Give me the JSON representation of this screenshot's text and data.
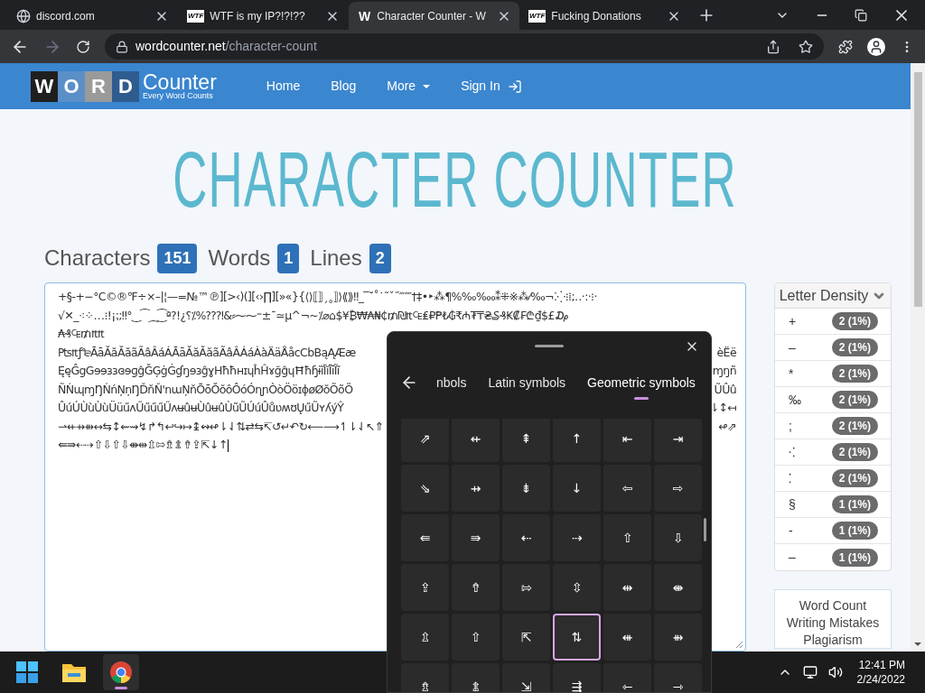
{
  "browser": {
    "tabs": [
      {
        "title": "discord.com",
        "kind": "globe",
        "selected": false
      },
      {
        "title": "WTF is my IP?!?!??",
        "kind": "text",
        "favicon": "WTF",
        "selected": false
      },
      {
        "title": "Character Counter - W",
        "kind": "text",
        "favicon": "W",
        "selected": true
      },
      {
        "title": "Fucking Donations",
        "kind": "text",
        "favicon": "WTF",
        "selected": false
      }
    ],
    "url_host": "wordcounter.net",
    "url_path": "/character-count"
  },
  "site": {
    "logo_letters": [
      "W",
      "O",
      "R",
      "D"
    ],
    "logo_name": "Counter",
    "tagline": "Every Word Counts",
    "nav": [
      {
        "label": "Home",
        "kind": "link"
      },
      {
        "label": "Blog",
        "kind": "link"
      },
      {
        "label": "More",
        "kind": "dropdown"
      },
      {
        "label": "Sign In",
        "kind": "signin"
      }
    ]
  },
  "heading": "CHARACTER COUNTER",
  "stats": [
    {
      "label": "Characters",
      "value": "151"
    },
    {
      "label": "Words",
      "value": "1"
    },
    {
      "label": "Lines",
      "value": "2"
    }
  ],
  "text_lines": [
    {
      "start": "+§-+−°C©®℉÷×–|¦—=№™℗][>‹)(][‹›∏][»«}{⟨⟩⟦⟧ˏ˳⟧⟩⟪⟫‼_‾˘˚˙˜ˇ˝‴⁗†‡•‣⁂¶%‰‱⁑⁜※⁂⁄‰¬⁚⁛⁝⁞;‥·:·⁝·"
    },
    {
      "start": "√✕_⁖⁘…⁝!¡⁏;‼°‿⁀⁔⁐ª?!¿⸮⁒%⁇⁈&⸗⁓⁓⁼±¯≃µ^¬~⁒⌀⌂$¥₿₩₳₦₵₥₪₶₠₤₽₱₺₲₹₼₮₸₴₷₰₭₡₣₾₫$£₯"
    },
    {
      "start": "₳₰₠₥₶₶"
    },
    {
      "start": "₧₶ƒ₻ĀāĂăĂăãÃâÂáÁĀāĂăĂăãÃâÂÁáÀàÄäÅåcCbBąĄÆæ",
      "end": "èËë"
    },
    {
      "start": "ĘęĜgGɘɘɜɜɞɘɡĝĞĢġĠɠŋɘɜĝɣHħħʜɪɥĥĤɤğĝɥĦħɧɨĩĬĭĪīĨĩ",
      "end": "ɱŋñ"
    },
    {
      "start": "ÑŃɰɱŊŃńŅņŊĎňŇ'nɯŅňŌōŎŏôÔóÓɳɲÒòÖöɪɸøØŏÕõÕ",
      "end": "ŨÛû"
    },
    {
      "start": "ÛúÚÙùÙùÜüűʌŰűűűŰʌʉûʉÙûʉûÙũŨÚúÛůʋʍʊŲűŨʏʎýŶ",
      "end": "⇂↕↤"
    },
    {
      "start": "⇀⇷⇸⇻↔⇆↕⇜⇝↯↱↰↩↪↦↨↭↫⇂⇃⇅⇄⇆↸↺↵↶↻⟵⟶↿⇂⇃↖⇑",
      "end": "↫⇗"
    },
    {
      "start": "⇚⇛⇠⇢⇧⇩⇧⇩⇼⇹⇫⇰⇯⇭⇮⇪⇱↓↑"
    }
  ],
  "density": {
    "title": "Letter Density",
    "rows": [
      {
        "symbol": "+",
        "count": "2 (1%)"
      },
      {
        "symbol": "–",
        "count": "2 (1%)"
      },
      {
        "symbol": "*",
        "count": "2 (1%)"
      },
      {
        "symbol": "‰",
        "count": "2 (1%)"
      },
      {
        "symbol": ";",
        "count": "2 (1%)"
      },
      {
        "symbol": "⁖",
        "count": "2 (1%)"
      },
      {
        "symbol": "⁚",
        "count": "2 (1%)"
      },
      {
        "symbol": "§",
        "count": "1 (1%)"
      },
      {
        "symbol": "-",
        "count": "1 (1%)"
      },
      {
        "symbol": "–",
        "count": "1 (1%)"
      }
    ]
  },
  "promo": [
    "Word Count",
    "Writing Mistakes",
    "Plagiarism"
  ],
  "symbol_panel": {
    "tabs": [
      {
        "label": "nbols",
        "selected": false
      },
      {
        "label": "Latin symbols",
        "selected": false
      },
      {
        "label": "Geometric symbols",
        "selected": true
      }
    ],
    "cells": [
      {
        "symbol": "⇗",
        "selected": false
      },
      {
        "symbol": "⇷",
        "selected": false
      },
      {
        "symbol": "⇞",
        "selected": false
      },
      {
        "symbol": "↑",
        "selected": false
      },
      {
        "symbol": "⇤",
        "selected": false
      },
      {
        "symbol": "⇥",
        "selected": false
      },
      {
        "symbol": "⇘",
        "selected": false
      },
      {
        "symbol": "⇸",
        "selected": false
      },
      {
        "symbol": "⇟",
        "selected": false
      },
      {
        "symbol": "↓",
        "selected": false
      },
      {
        "symbol": "⇦",
        "selected": false
      },
      {
        "symbol": "⇨",
        "selected": false
      },
      {
        "symbol": "⇚",
        "selected": false
      },
      {
        "symbol": "⇛",
        "selected": false
      },
      {
        "symbol": "⇠",
        "selected": false
      },
      {
        "symbol": "⇢",
        "selected": false
      },
      {
        "symbol": "⇧",
        "selected": false
      },
      {
        "symbol": "⇩",
        "selected": false
      },
      {
        "symbol": "⇪",
        "selected": false
      },
      {
        "symbol": "⇮",
        "selected": false
      },
      {
        "symbol": "⇰",
        "selected": false
      },
      {
        "symbol": "⇳",
        "selected": false
      },
      {
        "symbol": "⇹",
        "selected": false
      },
      {
        "symbol": "⇼",
        "selected": false
      },
      {
        "symbol": "⇫",
        "selected": false
      },
      {
        "symbol": "⇧",
        "selected": false
      },
      {
        "symbol": "⇱",
        "selected": false
      },
      {
        "symbol": "⇅",
        "selected": true
      },
      {
        "symbol": "⇺",
        "selected": false
      },
      {
        "symbol": "⇻",
        "selected": false
      },
      {
        "symbol": "⇯",
        "selected": false
      },
      {
        "symbol": "⇭",
        "selected": false
      },
      {
        "symbol": "⇲",
        "selected": false
      },
      {
        "symbol": "⇶",
        "selected": false
      },
      {
        "symbol": "⇽",
        "selected": false
      },
      {
        "symbol": "⇾",
        "selected": false
      }
    ]
  },
  "taskbar": {
    "apps": [
      {
        "kind": "start",
        "selected": false
      },
      {
        "kind": "files",
        "selected": false
      },
      {
        "kind": "browser",
        "selected": true
      }
    ],
    "time": "12:41 PM",
    "date": "2/24/2022"
  }
}
